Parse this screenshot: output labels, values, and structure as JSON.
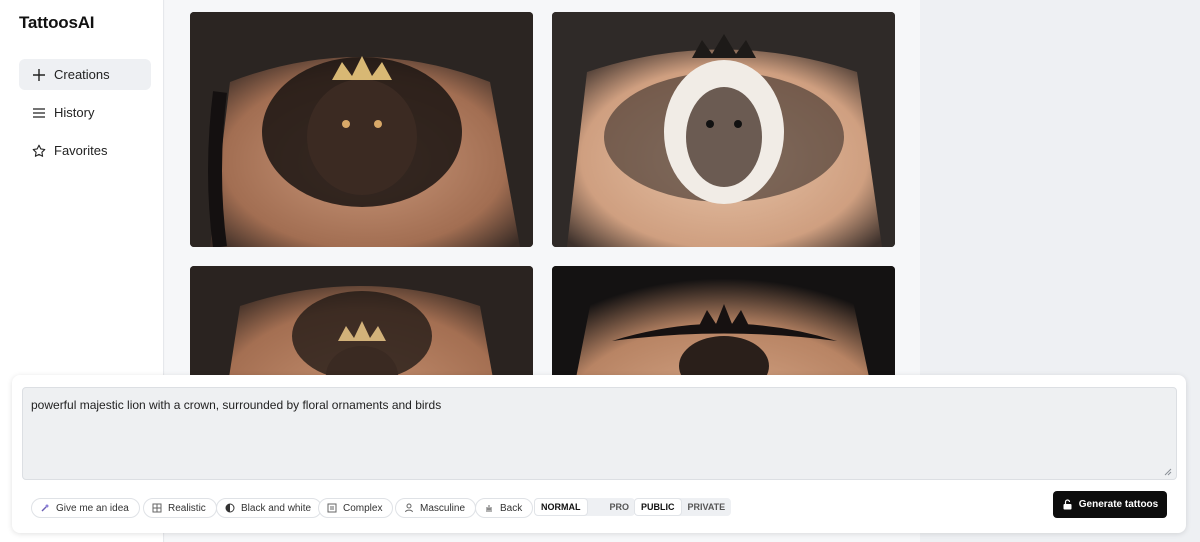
{
  "app": {
    "title": "TattoosAI"
  },
  "sidebar": {
    "items": [
      {
        "label": "Creations",
        "icon": "plus-icon",
        "active": true
      },
      {
        "label": "History",
        "icon": "list-icon",
        "active": false
      },
      {
        "label": "Favorites",
        "icon": "star-icon",
        "active": false
      }
    ]
  },
  "gallery": {
    "images": [
      {
        "icon": "tattoo-image"
      },
      {
        "icon": "tattoo-image"
      },
      {
        "icon": "tattoo-image"
      },
      {
        "icon": "tattoo-image"
      }
    ]
  },
  "prompt": {
    "value": "powerful majestic lion with a crown, surrounded by floral ornaments and birds"
  },
  "chips": {
    "idea": "Give me an idea",
    "realistic": "Realistic",
    "black_white": "Black and white",
    "complex": "Complex",
    "masculine": "Masculine",
    "back": "Back"
  },
  "quality_toggle": {
    "normal": "NORMAL",
    "pro": "PRO",
    "selected": "NORMAL"
  },
  "visibility_toggle": {
    "public": "PUBLIC",
    "private": "PRIVATE",
    "selected": "PUBLIC"
  },
  "generate": {
    "label": "Generate tattoos"
  },
  "colors": {
    "accent": "#0d0d0d",
    "panel": "#ffffff",
    "skin": "#c89a7a"
  }
}
